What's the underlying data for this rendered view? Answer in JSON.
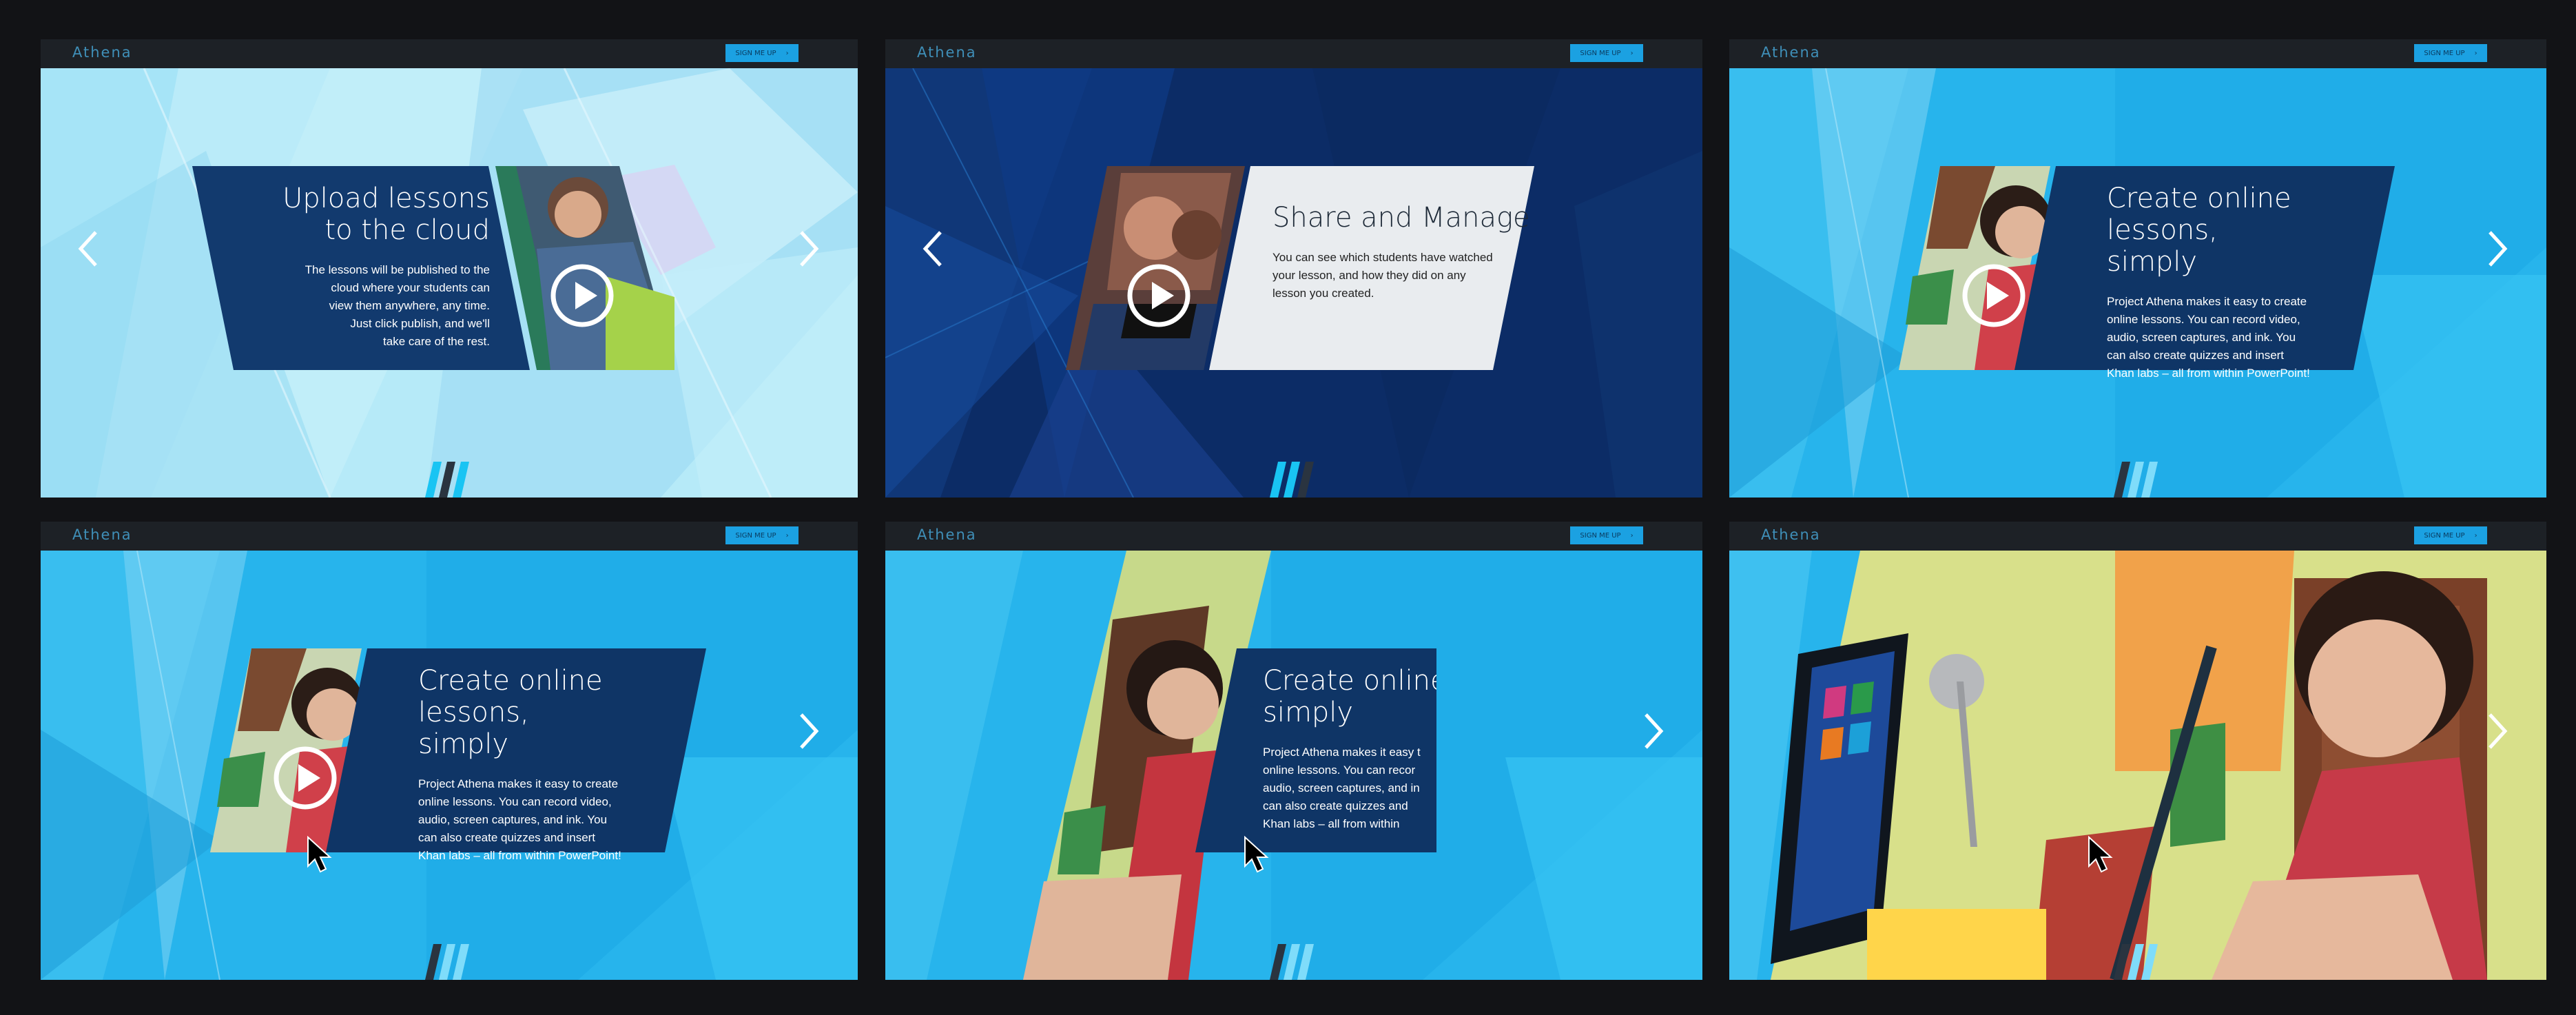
{
  "app": {
    "brand": "Athena",
    "signup_label": "SIGN ME UP",
    "signup_arrow": "›"
  },
  "colors": {
    "accent": "#1ba1e2",
    "navy": "#0f2f64",
    "light_card": "#e9ecef",
    "sky": "#29b6ee",
    "dark_blue": "#0a1f4d"
  },
  "slides": [
    {
      "title_line1": "Upload lessons",
      "title_line2": "to the cloud",
      "body_lines": [
        "The lessons will be published to the",
        "cloud where your students can",
        "view them anywhere, any time.",
        "Just click publish, and we'll",
        "take care of the rest."
      ]
    },
    {
      "title_line1": "Share and Manage",
      "body_lines": [
        "You can see which students have watched",
        "your lesson, and how they did on any",
        "lesson you created."
      ]
    },
    {
      "title_line1": "Create online lessons,",
      "title_line2": "simply",
      "body_lines": [
        "Project Athena makes it easy to create",
        "online lessons. You can record video,",
        "audio, screen captures, and ink. You",
        "can also create quizzes and insert",
        "Khan labs – all from within PowerPoint!"
      ]
    },
    {
      "title_line1": "Create online lessons,",
      "title_line2": "simply",
      "body_lines": [
        "Project Athena makes it easy to create",
        "online lessons. You can record video,",
        "audio, screen captures, and ink. You",
        "can also create quizzes and insert",
        "Khan labs – all from within PowerPoint!"
      ]
    },
    {
      "title_line1": "Create online le",
      "title_line2": "simply",
      "body_lines": [
        "Project Athena makes it easy t",
        "online lessons. You can recor",
        "audio, screen captures, and in",
        "can also create quizzes and",
        "Khan labs – all from within"
      ]
    }
  ]
}
